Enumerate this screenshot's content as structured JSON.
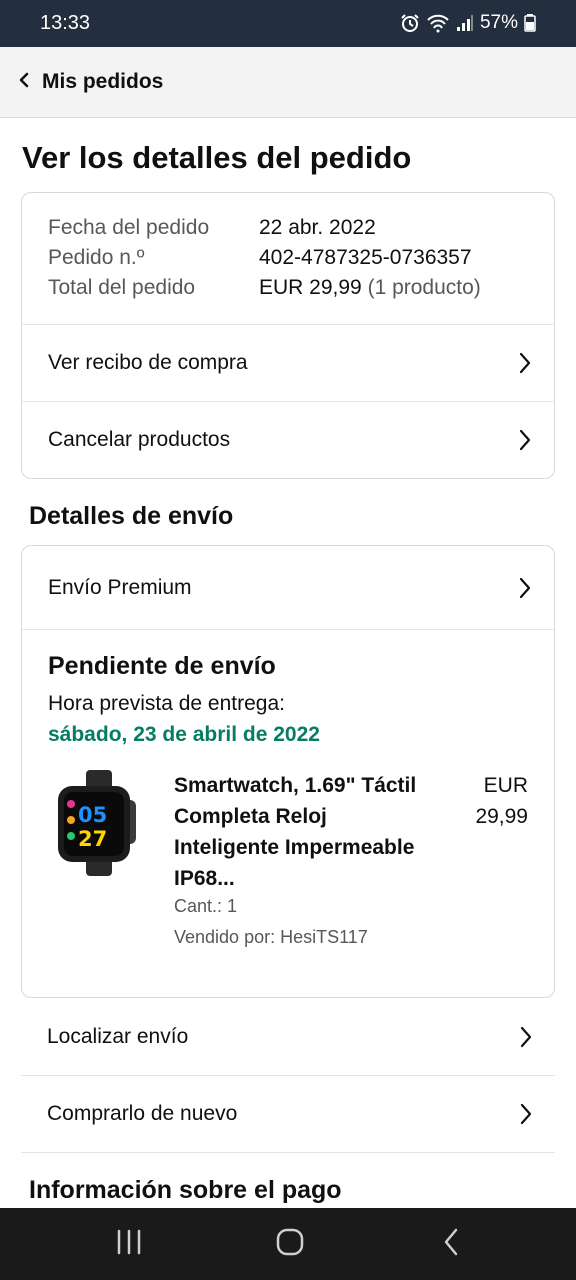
{
  "status_bar": {
    "time": "13:33",
    "battery": "57%",
    "icons": [
      "alarm-icon",
      "wifi-icon",
      "signal-icon",
      "battery-icon"
    ]
  },
  "header": {
    "back_label": "Mis pedidos"
  },
  "page": {
    "title": "Ver los detalles del pedido"
  },
  "order_summary": {
    "date_label": "Fecha del pedido",
    "date_value": "22 abr. 2022",
    "number_label": "Pedido n.º",
    "number_value": "402-4787325-0736357",
    "total_label": "Total del pedido",
    "total_value": "EUR 29,99",
    "total_qty": "(1 producto)",
    "actions": [
      {
        "label": "Ver recibo de compra"
      },
      {
        "label": "Cancelar productos"
      }
    ]
  },
  "shipping": {
    "section_title": "Detalles de envío",
    "method": "Envío Premium",
    "status": "Pendiente de envío",
    "eta_label": "Hora prevista de entrega:",
    "eta_date": "sábado, 23 de abril de 2022",
    "product": {
      "title": "Smartwatch, 1.69\" Táctil Completa Reloj Inteligente Impermeable IP68...",
      "price": "EUR 29,99",
      "qty": "Cant.: 1",
      "seller": "Vendido por: HesiTS117",
      "watch_digits_top": "05",
      "watch_digits_bottom": "27"
    },
    "actions": [
      {
        "label": "Localizar envío"
      },
      {
        "label": "Comprarlo de nuevo"
      }
    ]
  },
  "payment": {
    "section_title": "Información sobre el pago"
  },
  "colors": {
    "status_bar_bg": "#232f3e",
    "delivery_green": "#067d62",
    "nav_bar_bg": "#1a1a1a"
  }
}
